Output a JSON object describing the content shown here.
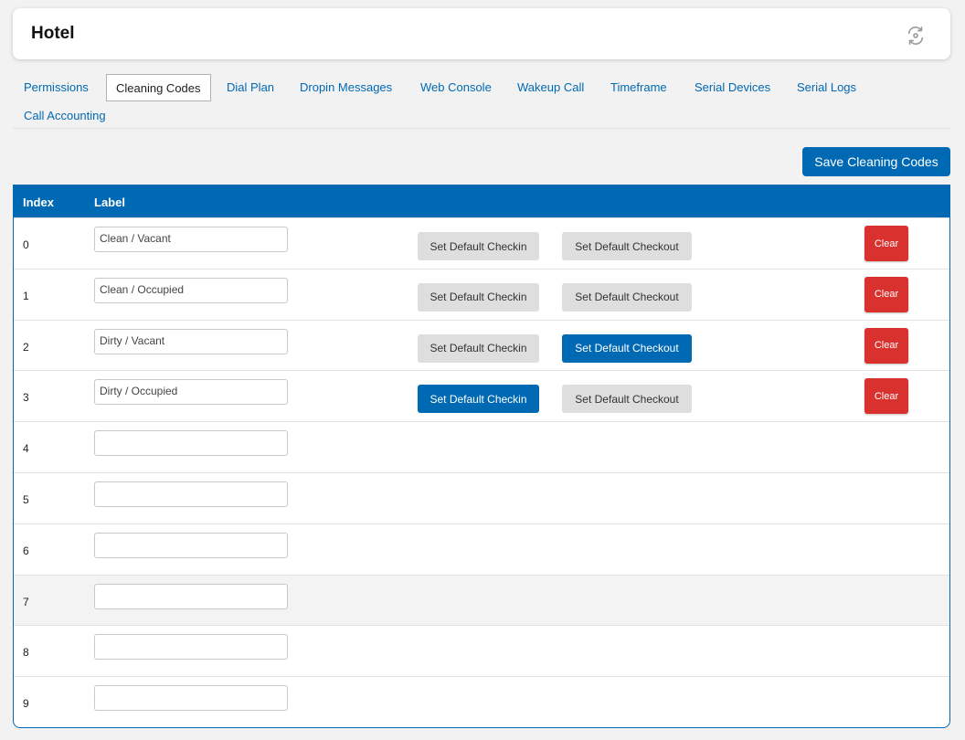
{
  "header": {
    "title": "Hotel",
    "refresh_icon": "refresh-icon"
  },
  "tabs": [
    {
      "label": "Permissions",
      "active": false
    },
    {
      "label": "Cleaning Codes",
      "active": true
    },
    {
      "label": "Dial Plan",
      "active": false
    },
    {
      "label": "Dropin Messages",
      "active": false
    },
    {
      "label": "Web Console",
      "active": false
    },
    {
      "label": "Wakeup Call",
      "active": false
    },
    {
      "label": "Timeframe",
      "active": false
    },
    {
      "label": "Serial Devices",
      "active": false
    },
    {
      "label": "Serial Logs",
      "active": false
    },
    {
      "label": "Call Accounting",
      "active": false
    }
  ],
  "toolbar": {
    "save_label": "Save Cleaning Codes"
  },
  "table": {
    "headers": {
      "index": "Index",
      "label": "Label"
    },
    "checkin_label": "Set Default Checkin",
    "checkout_label": "Set Default Checkout",
    "clear_label": "Clear",
    "rows": [
      {
        "index": "0",
        "label": "Clean / Vacant",
        "default_checkin": false,
        "default_checkout": false
      },
      {
        "index": "1",
        "label": "Clean / Occupied",
        "default_checkin": false,
        "default_checkout": false
      },
      {
        "index": "2",
        "label": "Dirty / Vacant",
        "default_checkin": false,
        "default_checkout": true
      },
      {
        "index": "3",
        "label": "Dirty / Occupied",
        "default_checkin": true,
        "default_checkout": false
      },
      {
        "index": "4",
        "label": ""
      },
      {
        "index": "5",
        "label": ""
      },
      {
        "index": "6",
        "label": ""
      },
      {
        "index": "7",
        "label": ""
      },
      {
        "index": "8",
        "label": ""
      },
      {
        "index": "9",
        "label": ""
      }
    ]
  },
  "colors": {
    "accent": "#0069b4",
    "danger": "#d9312e",
    "neutral_button": "#dedede"
  }
}
